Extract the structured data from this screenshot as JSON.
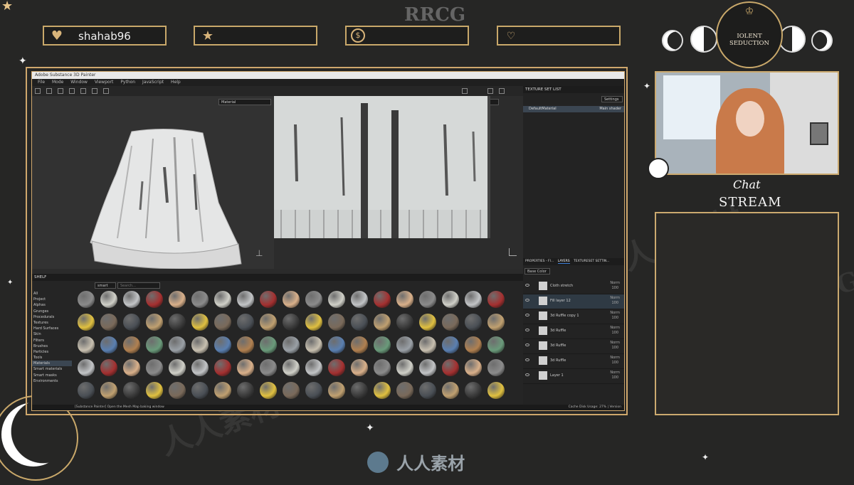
{
  "overlay": {
    "brand_watermark": "RRCG",
    "username": "shahab96",
    "stats": [
      "",
      "",
      ""
    ],
    "logo_line1": "IOLENT SEDUCTION",
    "chat_script": "Chat",
    "chat_title": "STREAM",
    "bottom_brand": "人人素材",
    "watermark_cn": "人人素材",
    "watermark_en": "RRCG"
  },
  "app": {
    "title": "Adobe Substance 3D Painter",
    "menu": [
      "File",
      "Mode",
      "Window",
      "Viewport",
      "Python",
      "JavaScript",
      "Help"
    ],
    "viewport_3d_mode": "Material",
    "viewport_2d_mode": "Material",
    "texture_set_panel": {
      "title": "TEXTURE SET LIST",
      "settings_label": "Settings",
      "item": "DefaultMaterial",
      "item_shader": "Main shader"
    },
    "layers_tabs": [
      "PROPERTIES - FI...",
      "LAYERS",
      "TEXTURESET SETTIN..."
    ],
    "blend_mode": "Base Color",
    "layers": [
      {
        "name": "Cloth stretch",
        "blend": "Norm",
        "opacity": "100"
      },
      {
        "name": "Fill layer 12",
        "blend": "Norm",
        "opacity": "100"
      },
      {
        "name": "3d Ruffle copy 1",
        "blend": "Norm",
        "opacity": "100"
      },
      {
        "name": "3d Ruffle",
        "blend": "Norm",
        "opacity": "100"
      },
      {
        "name": "3d Ruffle",
        "blend": "Norm",
        "opacity": "100"
      },
      {
        "name": "3d Ruffle",
        "blend": "Norm",
        "opacity": "100"
      },
      {
        "name": "Layer 1",
        "blend": "Norm",
        "opacity": "100"
      }
    ],
    "shelf": {
      "title": "SHELF",
      "search_placeholder": "Search...",
      "filter_tag": "smart",
      "categories": [
        "All",
        "Project",
        "Alphas",
        "Grunges",
        "Procedurals",
        "Textures",
        "Hard Surfaces",
        "Skin",
        "Filters",
        "Brushes",
        "Particles",
        "Tools",
        "Materials",
        "Smart materials",
        "Smart masks",
        "Environments"
      ]
    },
    "status_left": "[Substance Painter] Open the Mesh Map baking window",
    "status_right": "Cache Disk Usage: 27% | Version"
  },
  "colors": {
    "gold": "#cba96f",
    "frame_bg": "#262625",
    "app_bg": "#2b2b2b"
  }
}
